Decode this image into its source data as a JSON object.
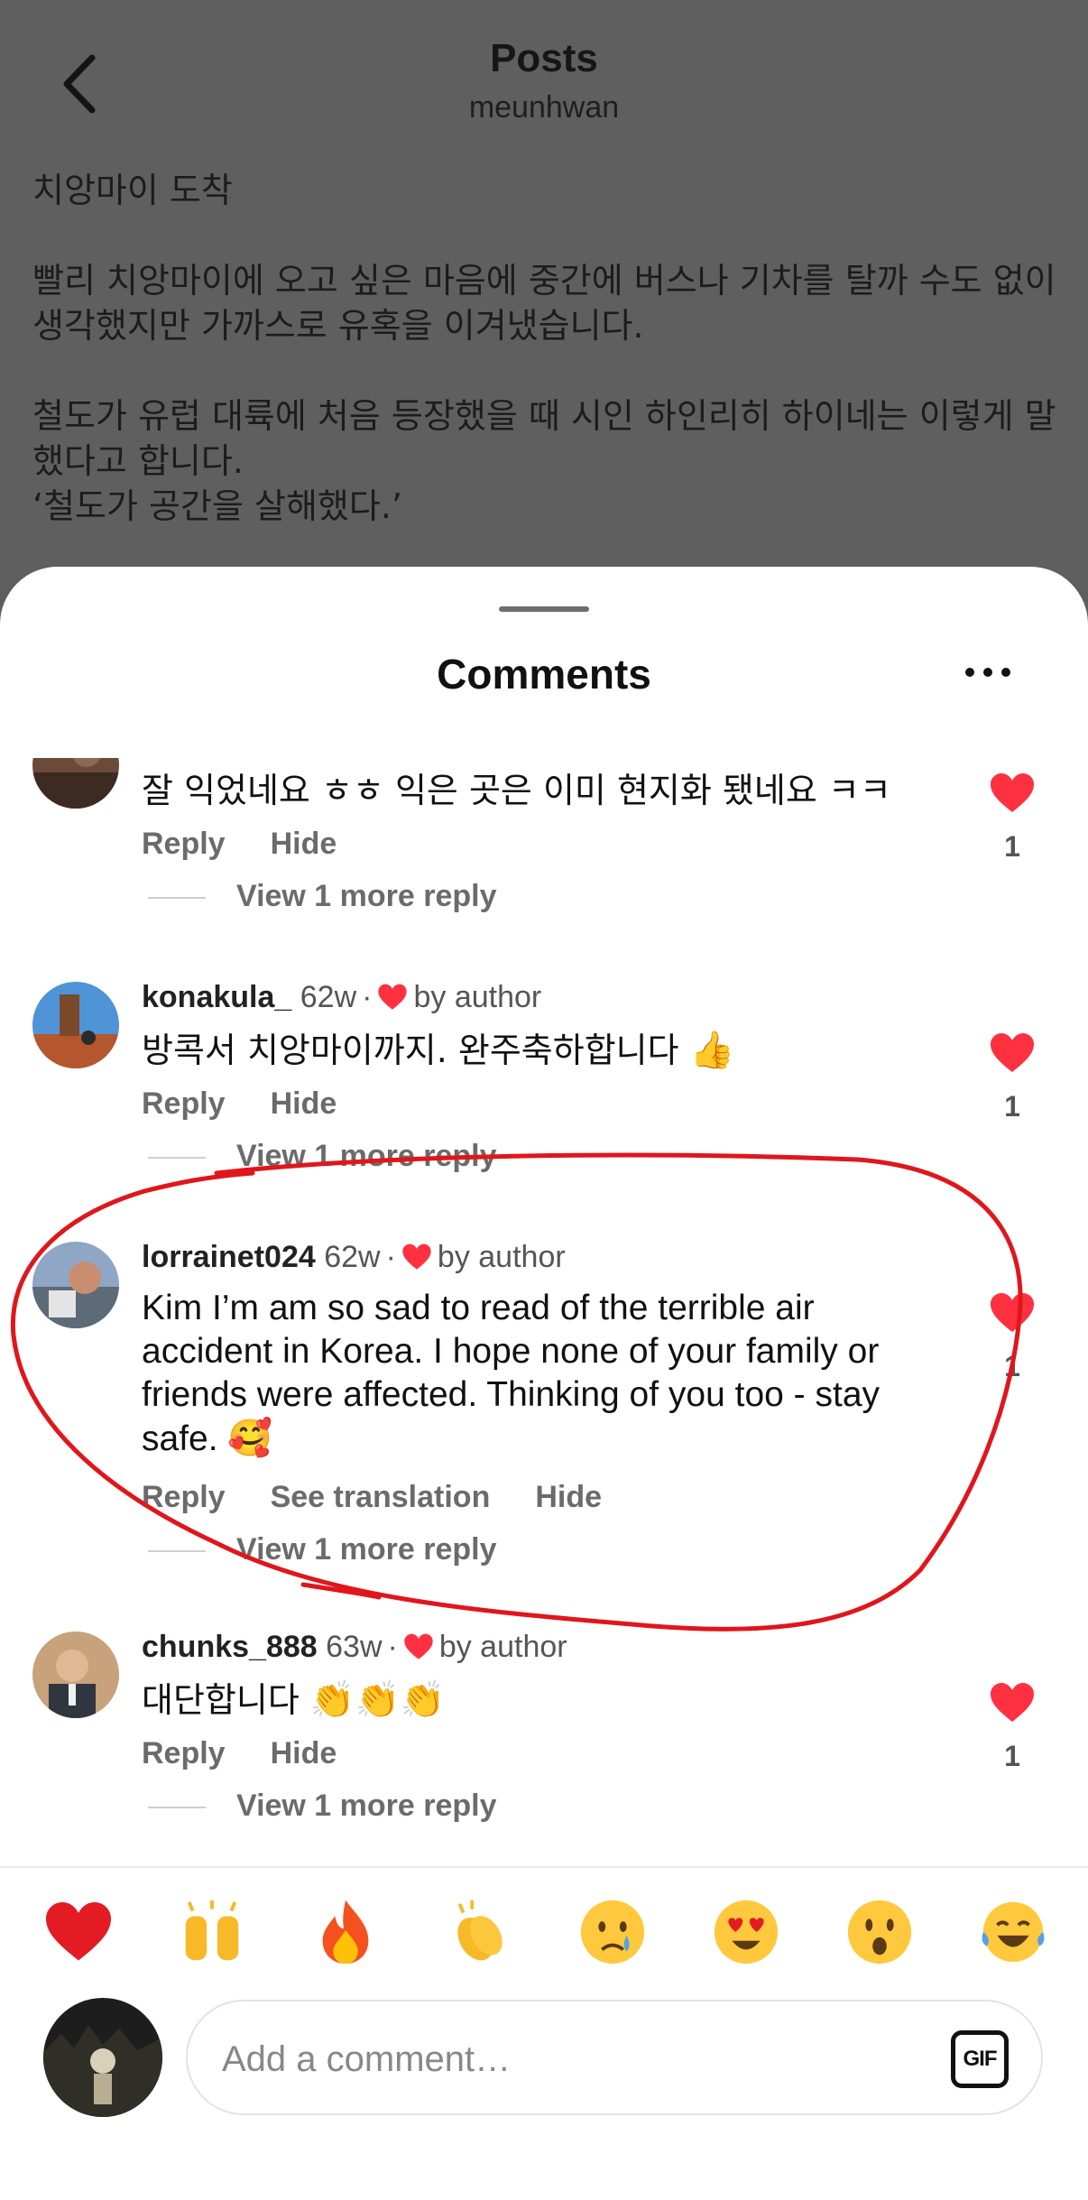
{
  "nav": {
    "title": "Posts",
    "subtitle": "meunhwan"
  },
  "post": {
    "p1": "치앙마이 도착",
    "p2": "빨리 치앙마이에 오고 싶은 마음에 중간에 버스나 기차를 탈까 수도 없이 생각했지만 가까스로 유혹을 이겨냈습니다.",
    "p3a": "철도가 유럽 대륙에 처음 등장했을 때 시인 하인리히 하이네는 이렇게 말했다고 합니다.",
    "p3b": "‘철도가 공간을 살해했다.’"
  },
  "sheet": {
    "title": "Comments"
  },
  "comments": [
    {
      "text": "잘 익었네요 ㅎㅎ 익은 곳은 이미 현지화 됐네요 ㅋㅋ",
      "actions": [
        "Reply",
        "Hide"
      ],
      "view_more": "View 1 more reply",
      "likes": "1"
    },
    {
      "username": "konakula_",
      "time": "62w",
      "by_author": "by author",
      "text": "방콕서 치앙마이까지.  완주축하합니다",
      "emoji": "👍",
      "actions": [
        "Reply",
        "Hide"
      ],
      "view_more": "View 1 more reply",
      "likes": "1"
    },
    {
      "username": "lorrainet024",
      "time": "62w",
      "by_author": "by author",
      "text": "Kim I’m am so sad to read of the terrible air accident in Korea. I hope none of your family or friends were affected. Thinking of you too - stay safe.",
      "emoji": "🥰",
      "actions": [
        "Reply",
        "See translation",
        "Hide"
      ],
      "view_more": "View 1 more reply",
      "likes": "1"
    },
    {
      "username": "chunks_888",
      "time": "63w",
      "by_author": "by author",
      "text": "대단합니다",
      "emoji": "👏👏👏",
      "actions": [
        "Reply",
        "Hide"
      ],
      "view_more": "View 1 more reply",
      "likes": "1"
    }
  ],
  "reactions": [
    "red-heart",
    "raising-hands",
    "fire",
    "clapping-hands",
    "crying-face",
    "heart-eyes",
    "surprised-face",
    "tears-of-joy"
  ],
  "composer": {
    "placeholder": "Add a comment…",
    "gif_label": "GIF"
  },
  "colors": {
    "like_red": "#ff3040",
    "annotation_red": "#e0161b",
    "dim_overlay": "#5f5f5f"
  }
}
